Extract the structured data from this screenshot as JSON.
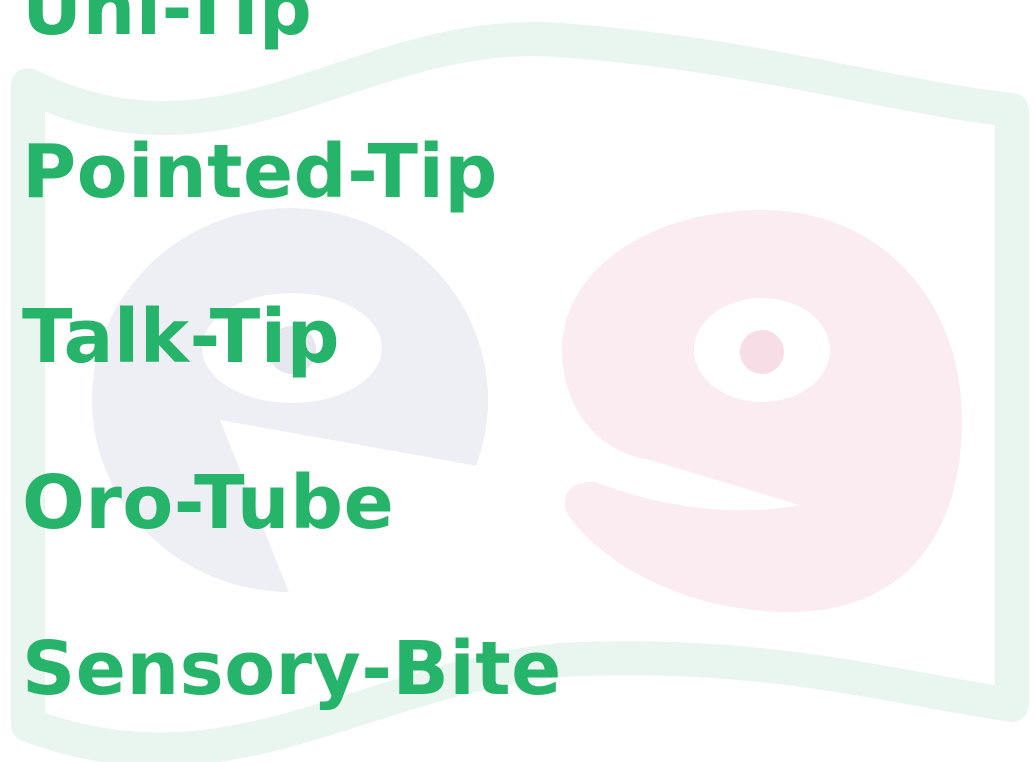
{
  "colors": {
    "text": "#26b36a",
    "ribbon": "#e8f6ef",
    "logo_e": "#eeeff4",
    "logo_g": "#fbecf1",
    "eye": "#ffffff",
    "pupil_e": "#e5e6ee",
    "pupil_g": "#f6dde6"
  },
  "watermark": {
    "icon": "e9-logo-watermark"
  },
  "tips": [
    "Uni-Tip",
    "Pointed-Tip",
    "Talk-Tip",
    "Oro-Tube",
    "Sensory-Bite"
  ]
}
